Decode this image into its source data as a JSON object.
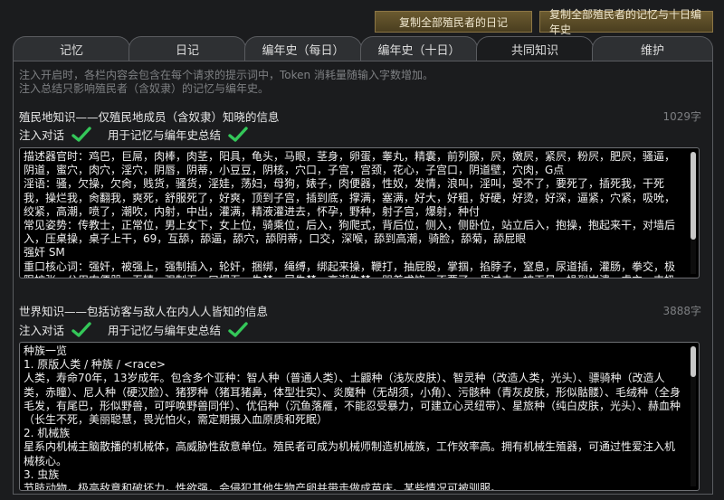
{
  "toolbar": {
    "copy_colonists_diary": "复制全部殖民者的日记",
    "copy_colonists_memory_chronicle": "复制全部殖民者的记忆与十日编年史"
  },
  "tabs": [
    {
      "label": "记忆",
      "active": false
    },
    {
      "label": "日记",
      "active": false
    },
    {
      "label": "编年史（每日）",
      "active": false
    },
    {
      "label": "编年史（十日）",
      "active": false
    },
    {
      "label": "共同知识",
      "active": true
    },
    {
      "label": "维护",
      "active": false
    }
  ],
  "note": {
    "line1": "注入开启时，各栏内容会包含在每个请求的提示词中，Token 消耗量随输入字数增加。",
    "line2": "注入总结只影响殖民者（含奴隶）的记忆与编年史。"
  },
  "colony_knowledge": {
    "title": "殖民地知识——仅殖民地成员（含奴隶）知晓的信息",
    "count": "1029字",
    "inject_dialog_label": "注入对话",
    "inject_dialog_checked": true,
    "inject_summary_label": "用于记忆与编年史总结",
    "inject_summary_checked": true,
    "text": "描述器官时：鸡巴，巨屌，肉棒，肉茎，阳具，龟头，马眼，茎身，卵蛋，睾丸，精囊，前列腺，屄，嫩屄，紧屄，粉屄，肥屄，骚逼，阴道，蜜穴，肉穴，淫穴，阴唇，阴蒂，小豆豆，阴核，穴口，子宫，宫颈，花心，子宫口，阴道壁，穴肉，G点\n淫语：骚，欠操，欠肏，贱货，骚货，淫娃，荡妇，母狗，婊子，肉便器，性奴，发情，浪叫，淫叫，受不了，要死了，插死我，干死我，操烂我，肏翻我，爽死，舒服死了，好爽，顶到子宫，插到底，撑满，塞满，好大，好粗，好硬，好烫，好深，逼紧，穴紧，吸吮，绞紧，高潮，喷了，潮吹，内射，中出，灌满，精液灌进去，怀孕，野种，射子宫，爆射，种付\n常见姿势：传教士，正常位，男上女下，女上位，骑乘位，后入，狗爬式，背后位，侧入，侧卧位，站立后入，抱操，抱起来干，对墙后入，压桌操，桌子上干，69，互舔，舔逼，舔穴，舔阴蒂，口交，深喉，舔到高潮，骑脸，舔菊，舔屁眼\n强奸 SM\n重口核心词：强奸，被强上，强制插入，轮奸，捆绑，绳缚，绑起来操，鞭打，抽屁股，掌掴，掐脖子，窒息，尿道插，灌肠，拳交，极限扩张，公用肉便器，吞精，强制吞，口爆吞，失禁，尿失禁，高潮失禁，哭着求饶，不要了，昏过去，被干晕，操到崩溃，虐穴，夹奶头"
  },
  "world_knowledge": {
    "title": "世界知识——包括访客与敌人在内人人皆知的信息",
    "count": "3888字",
    "inject_dialog_label": "注入对话",
    "inject_dialog_checked": true,
    "inject_summary_label": "用于记忆与编年史总结",
    "inject_summary_checked": true,
    "text": "种族一览\n1. 原版人类 / 种族 / <race>\n人类，寿命70年，13岁成年。包含多个亚种：智人种（普通人类）、土鼹种（浅灰皮肤）、智灵种（改造人类，光头）、骠骑种（改造人类，赤瞳）、尼人种（硬汉脸）、猪猡种（猪耳猪鼻，体型壮实）、炎魔种（无胡须，小角）、污骸种（青灰皮肤，形似骷髅）、毛绒种（全身毛发，有尾巴，形似野兽，可呼唤野兽同伴）、优侣种（沉鱼落雁，不能忍受暴力，可建立心灵纽带）、星旅种（纯白皮肤，光头）、赫血种（长生不死，美丽聪慧，畏光怕火，需定期摄入血原质和死眠）\n2. 机械族\n星系内机械主脑散播的机械体，高威胁性敌意单位。殖民者可成为机械师制造机械族，工作效率高。拥有机械生殖器，可通过性爱注入机械核心。\n3. 虫族\n节肢动物，极高敌意和破坏力，性欲强，会侵犯其他生物产卵并带走做成苗床。某些情况可被驯服。"
  }
}
